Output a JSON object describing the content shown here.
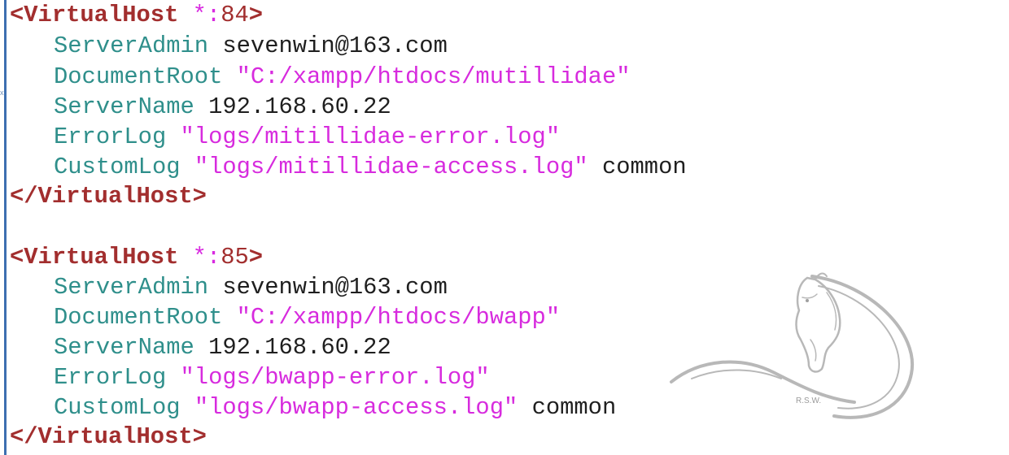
{
  "gutter": {
    "mark": "x"
  },
  "colors": {
    "tag": "#a22e2e",
    "directive": "#2f8f8b",
    "string": "#d72bde",
    "plain": "#1f1f1f",
    "gutter_line": "#3d6fb0"
  },
  "blocks": [
    {
      "open_tag": "<VirtualHost",
      "star": "*:",
      "port": "84",
      "open_close": ">",
      "server_admin": {
        "key": "ServerAdmin",
        "value": "sevenwin@163.com"
      },
      "document_root": {
        "key": "DocumentRoot",
        "value": "\"C:/xampp/htdocs/mutillidae\""
      },
      "server_name": {
        "key": "ServerName",
        "value": "192.168.60.22"
      },
      "error_log": {
        "key": "ErrorLog",
        "value": "\"logs/mitillidae-error.log\""
      },
      "custom_log": {
        "key": "CustomLog",
        "value": "\"logs/mitillidae-access.log\"",
        "format": "common"
      },
      "close_tag": "</VirtualHost>"
    },
    {
      "open_tag": "<VirtualHost",
      "star": "*:",
      "port": "85",
      "open_close": ">",
      "server_admin": {
        "key": "ServerAdmin",
        "value": "sevenwin@163.com"
      },
      "document_root": {
        "key": "DocumentRoot",
        "value": "\"C:/xampp/htdocs/bwapp\""
      },
      "server_name": {
        "key": "ServerName",
        "value": "192.168.60.22"
      },
      "error_log": {
        "key": "ErrorLog",
        "value": "\"logs/bwapp-error.log\""
      },
      "custom_log": {
        "key": "CustomLog",
        "value": "\"logs/bwapp-access.log\"",
        "format": "common"
      },
      "close_tag": "</VirtualHost>"
    }
  ],
  "watermark": {
    "text": "R.S.W."
  }
}
